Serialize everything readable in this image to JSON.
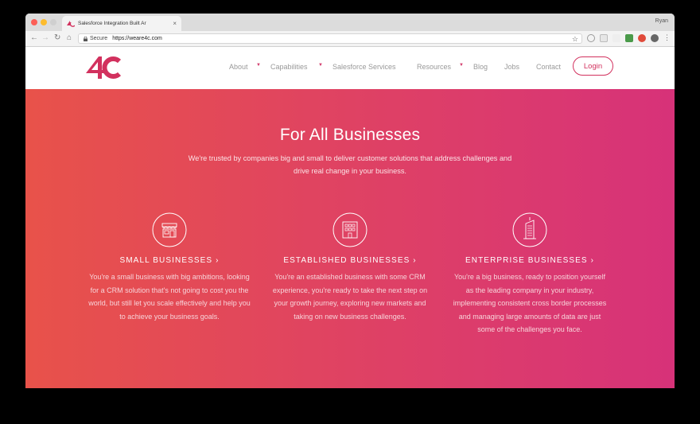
{
  "browser": {
    "tab_title": "Salesforce Integration Built Ar",
    "tab_close": "×",
    "profile_name": "Ryan",
    "secure_label": "Secure",
    "url": "https://weare4c.com",
    "star": "☆"
  },
  "site": {
    "logo_alt": "4C",
    "nav": [
      {
        "label": "About",
        "has_dropdown": true
      },
      {
        "label": "Capabilities",
        "has_dropdown": true
      },
      {
        "label": "Salesforce Services",
        "has_dropdown": false
      },
      {
        "label": "Resources",
        "has_dropdown": true
      },
      {
        "label": "Blog",
        "has_dropdown": false
      },
      {
        "label": "Jobs",
        "has_dropdown": false
      },
      {
        "label": "Contact",
        "has_dropdown": false
      }
    ],
    "login_label": "Login"
  },
  "hero": {
    "title": "For All Businesses",
    "subtitle": "We're trusted by companies big and small to deliver customer solutions that address challenges and drive real change in your business."
  },
  "features": [
    {
      "icon": "shop-icon",
      "heading": "SMALL BUSINESSES ›",
      "text": "You're a small business with big ambitions, looking for a CRM solution that's not going to cost you the world, but still let you scale effectively and help you to achieve your business goals."
    },
    {
      "icon": "office-building-icon",
      "heading": "ESTABLISHED BUSINESSES ›",
      "text": "You're an established business with some CRM experience, you're ready to take the next step on your growth journey, exploring new markets and taking on new business challenges."
    },
    {
      "icon": "skyscraper-icon",
      "heading": "ENTERPRISE BUSINESSES ›",
      "text": "You're a big business, ready to position yourself as the leading company in your industry, implementing consistent cross border processes and managing large amounts of data are just some of the challenges you face."
    }
  ],
  "colors": {
    "brand": "#d2315e",
    "hero_gradient_start": "#e8524a",
    "hero_gradient_end": "#d73279"
  }
}
